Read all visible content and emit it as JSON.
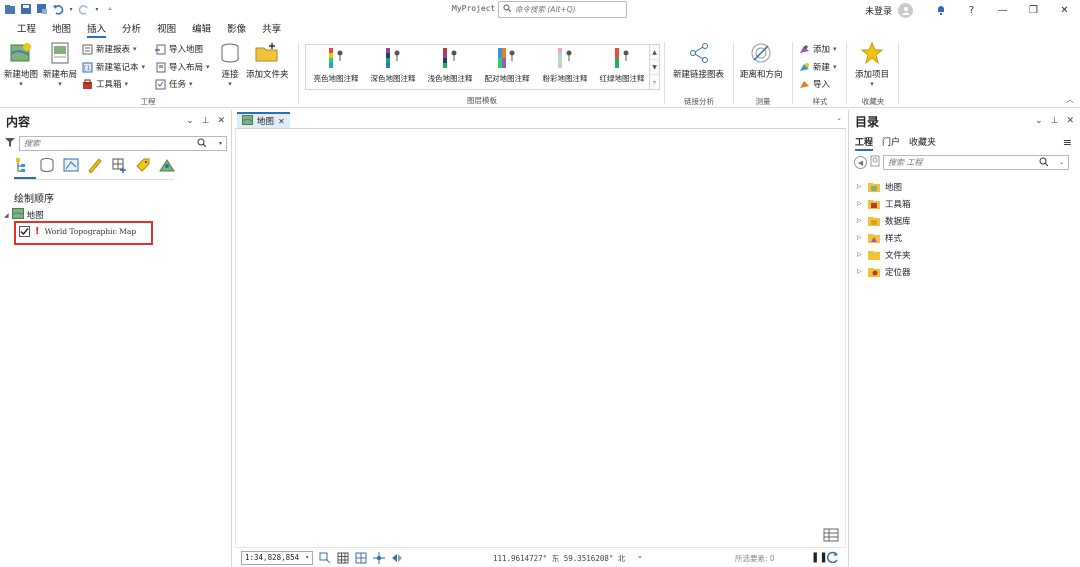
{
  "app": {
    "title": "MyProject",
    "command_search_placeholder": "命令搜索 (Alt+Q)",
    "login_text": "未登录",
    "help": "?"
  },
  "tabs": [
    "工程",
    "地图",
    "插入",
    "分析",
    "视图",
    "编辑",
    "影像",
    "共享"
  ],
  "active_tab": "插入",
  "ribbon": {
    "project_group": {
      "label": "工程",
      "new_map": "新建地图",
      "new_layout": "新建布局",
      "new_report": "新建报表",
      "new_notebook": "新建笔记本",
      "toolbox": "工具箱",
      "import_map": "导入地图",
      "import_layout": "导入布局",
      "task": "任务",
      "connect": "连接",
      "add_folder": "添加文件夹"
    },
    "layer_templates": {
      "label": "图层模板",
      "items": [
        "亮色地图注释",
        "深色地图注释",
        "浅色地图注释",
        "配对地图注释",
        "粉彩地图注释",
        "红绿地图注释"
      ]
    },
    "link_analysis": {
      "label": "链接分析",
      "button": "新建链接图表"
    },
    "measure": {
      "label": "测量",
      "button": "距离和方向"
    },
    "styles": {
      "label": "样式",
      "add": "添加",
      "new": "新建",
      "import": "导入"
    },
    "favorites": {
      "label": "收藏夹",
      "button": "添加项目"
    }
  },
  "contents": {
    "title": "内容",
    "search_placeholder": "搜索",
    "draw_order": "绘制顺序",
    "map_name": "地图",
    "layer": "World Topographic Map",
    "layer_checked": true
  },
  "map_view": {
    "tab_label": "地图",
    "scale": "1:34,828,854",
    "coordinates": "111.9614727° 东 59.3516208° 北",
    "selected_features": "所选要素: 0"
  },
  "catalog": {
    "title": "目录",
    "tabs": [
      "工程",
      "门户",
      "收藏夹"
    ],
    "search_placeholder": "搜索 工程",
    "items": [
      "地图",
      "工具箱",
      "数据库",
      "样式",
      "文件夹",
      "定位器"
    ]
  },
  "colors": {
    "accent": "#2b6fb4",
    "highlight_border": "#e0312b",
    "tab_active_bg": "#e3ecf6"
  }
}
